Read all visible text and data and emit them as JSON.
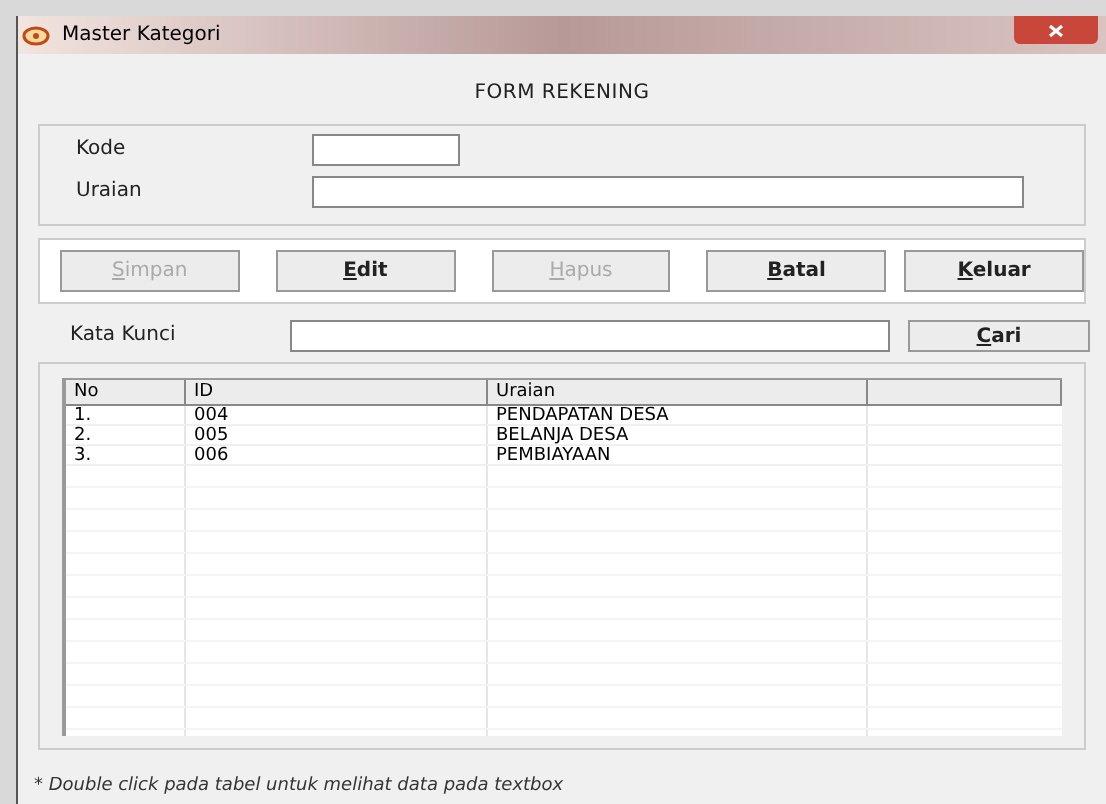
{
  "window": {
    "title": "Master Kategori"
  },
  "form_title": "FORM REKENING",
  "fields": [
    {
      "label": "Kode",
      "kind": "short"
    },
    {
      "label": "Uraian",
      "kind": "long"
    }
  ],
  "buttons": [
    {
      "label": "Simpan",
      "disabled": true
    },
    {
      "label": "Edit",
      "disabled": false
    },
    {
      "label": "Hapus",
      "disabled": true
    },
    {
      "label": "Batal",
      "disabled": false
    },
    {
      "label": "Keluar",
      "disabled": false
    }
  ],
  "search": {
    "label": "Kata Kunci",
    "button": {
      "label": "Cari"
    }
  },
  "table": {
    "columns": [
      "No",
      "ID",
      "Uraian"
    ],
    "rows": [
      [
        "1.",
        "004",
        "PENDAPATAN DESA"
      ],
      [
        "2.",
        "005",
        "BELANJA DESA"
      ],
      [
        "3.",
        "006",
        "PEMBIAYAAN"
      ]
    ]
  },
  "footnote": "* Double click pada tabel untuk melihat data pada textbox"
}
